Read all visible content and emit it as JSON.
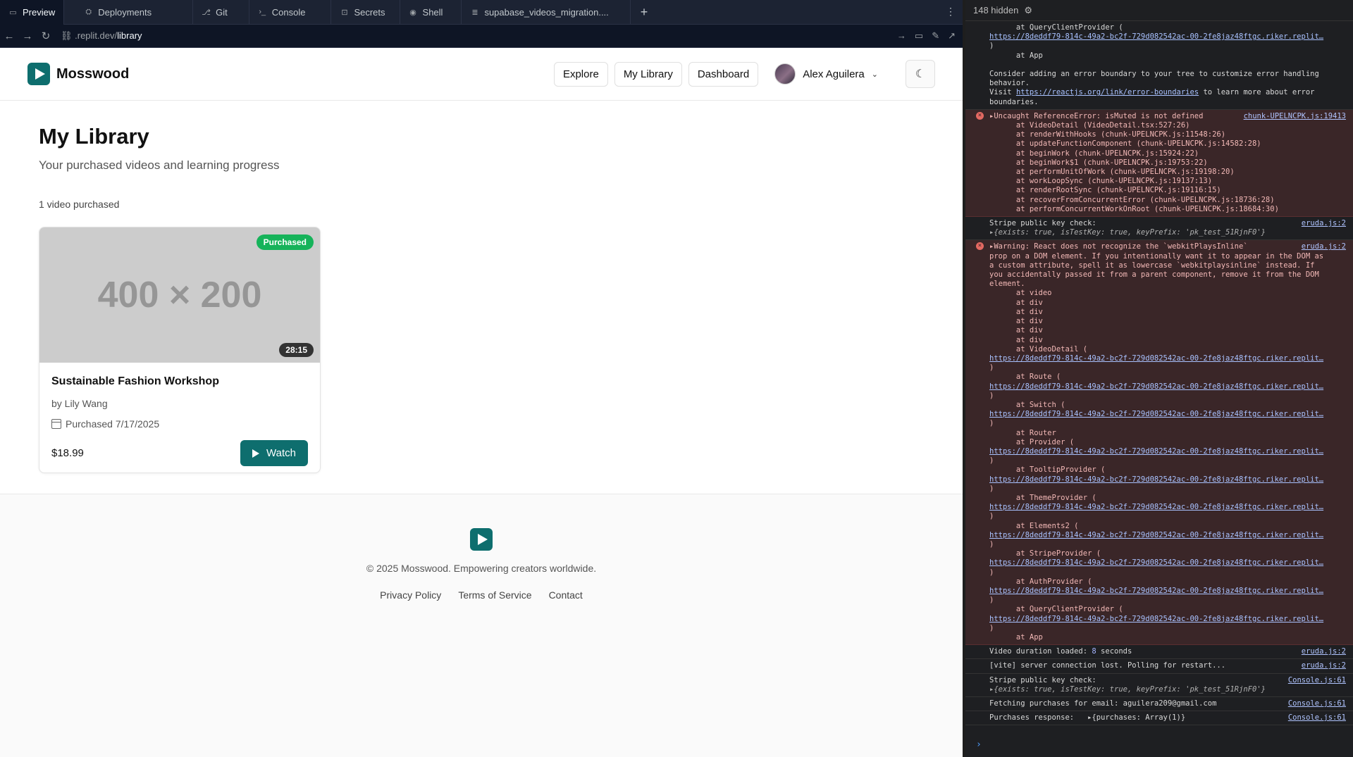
{
  "browser": {
    "tabs": [
      {
        "icon": "preview-icon",
        "glyph": "▭",
        "label": "Preview"
      },
      {
        "icon": "deployments-icon",
        "glyph": "⛭",
        "label": "Deployments"
      },
      {
        "icon": "git-icon",
        "glyph": "⎇",
        "label": "Git"
      },
      {
        "icon": "console-icon",
        "glyph": ">_",
        "label": "Console"
      },
      {
        "icon": "lock-icon",
        "glyph": "🔒",
        "label": "Secrets"
      },
      {
        "icon": "shell-icon",
        "glyph": "⚙",
        "label": "Shell"
      },
      {
        "icon": "database-icon",
        "glyph": "≣",
        "label": "supabase_videos_migration...."
      }
    ],
    "url_prefix": ".replit.dev/",
    "url_path": "library"
  },
  "header": {
    "brand": "Mosswood",
    "nav": [
      "Explore",
      "My Library",
      "Dashboard"
    ],
    "user_name": "Alex Aguilera"
  },
  "page": {
    "title": "My Library",
    "subtitle": "Your purchased videos and learning progress",
    "count": "1 video purchased"
  },
  "card": {
    "thumbnail_text": "400 × 200",
    "badge": "Purchased",
    "duration": "28:15",
    "title": "Sustainable Fashion Workshop",
    "author": "by Lily Wang",
    "purchased": "Purchased 7/17/2025",
    "price": "$18.99",
    "watch_label": "Watch"
  },
  "footer": {
    "copyright": "© 2025 Mosswood. Empowering creators worldwide.",
    "links": [
      "Privacy Policy",
      "Terms of Service",
      "Contact"
    ]
  },
  "console": {
    "hidden_count": "148 hidden",
    "url_snippet": "https://8deddf79-814c-49a2-bc2f-729d082542ac-00-2fe8jaz48ftgc.riker.replit…",
    "entries": {
      "e1": "      at QueryClientProvider (",
      "e1b": ")\n      at App\n\nConsider adding an error boundary to your tree to customize error handling\nbehavior.",
      "e1c_pre": "Visit ",
      "e1c_link": "https://reactjs.org/link/error-boundaries",
      "e1c_post": " to learn more about error\nboundaries.",
      "err1_title": "▸Uncaught ReferenceError: isMuted is not defined",
      "err1_src": "chunk-UPELNCPK.js:19413",
      "err1_stack": "      at VideoDetail (VideoDetail.tsx:527:26)\n      at renderWithHooks (chunk-UPELNCPK.js:11548:26)\n      at updateFunctionComponent (chunk-UPELNCPK.js:14582:28)\n      at beginWork (chunk-UPELNCPK.js:15924:22)\n      at beginWork$1 (chunk-UPELNCPK.js:19753:22)\n      at performUnitOfWork (chunk-UPELNCPK.js:19198:20)\n      at workLoopSync (chunk-UPELNCPK.js:19137:13)\n      at renderRootSync (chunk-UPELNCPK.js:19116:15)\n      at recoverFromConcurrentError (chunk-UPELNCPK.js:18736:28)\n      at performConcurrentWorkOnRoot (chunk-UPELNCPK.js:18684:30)",
      "stripe1": "Stripe public key check:",
      "stripe_obj": "▸{exists: true, isTestKey: true, keyPrefix: 'pk_test_51RjnF0'}",
      "eruda": "eruda.js:2",
      "warn_title": "▸Warning: React does not recognize the `webkitPlaysInline`\nprop on a DOM element. If you intentionally want it to appear in the DOM as\na custom attribute, spell it as lowercase `webkitplaysinline` instead. If\nyou accidentally passed it from a parent component, remove it from the DOM\nelement.\n      at video\n      at div\n      at div\n      at div\n      at div\n      at div\n      at VideoDetail (",
      "stack_route": "      at Route (",
      "stack_switch": "      at Switch (",
      "stack_router": "      at Router\n      at Provider (",
      "stack_tooltip": "      at TooltipProvider (",
      "stack_theme": "      at ThemeProvider (",
      "stack_elements": "      at Elements2 (",
      "stack_stripe": "      at StripeProvider (",
      "stack_auth": "      at AuthProvider (",
      "stack_query": "      at QueryClientProvider (",
      "stack_app": "      at App",
      "video_duration_pre": "Video duration loaded: ",
      "video_duration_num": "8",
      "video_duration_post": " seconds",
      "vite": "[vite] server connection lost. Polling for restart...",
      "console_src": "Console.js:61",
      "fetch": "Fetching purchases for email: aguilera209@gmail.com",
      "purchases": "Purchases response:   ▸{purchases: Array(1)}"
    }
  }
}
